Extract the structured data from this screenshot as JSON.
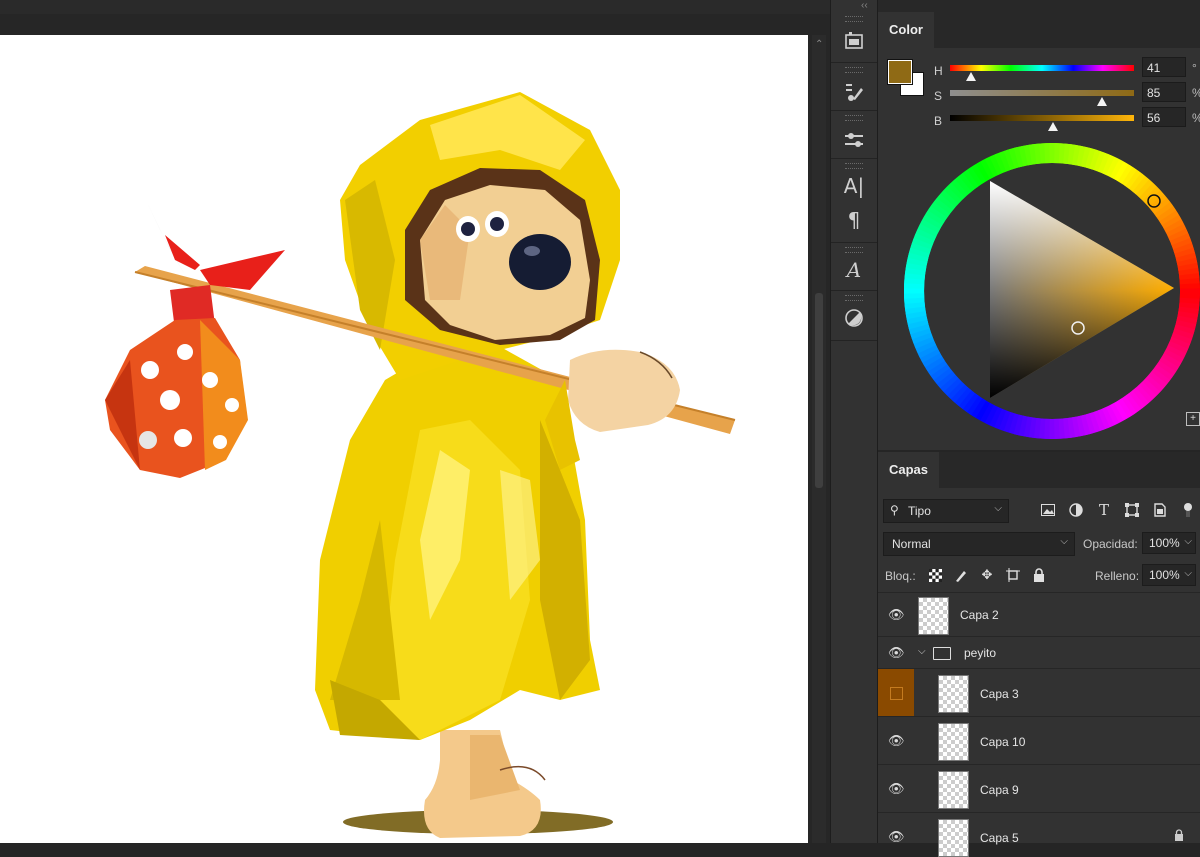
{
  "toolstrip": {
    "icons": [
      "layer-comps-icon",
      "brush-settings-icon",
      "adjustments-icon",
      "character-icon",
      "paragraph-icon",
      "glyphs-icon",
      "fill-opacity-icon"
    ]
  },
  "color_panel": {
    "tab": "Color",
    "foreground": "#8f6a15",
    "background": "#ffffff",
    "sliders": [
      {
        "label": "H",
        "value": "41",
        "unit": "°",
        "fraction": 0.11
      },
      {
        "label": "S",
        "value": "85",
        "unit": "%",
        "fraction": 0.85
      },
      {
        "label": "B",
        "value": "56",
        "unit": "%",
        "fraction": 0.56
      }
    ],
    "hue_color": "#ffad00"
  },
  "layers_panel": {
    "tab": "Capas",
    "filter": {
      "icon": "search-icon",
      "label": "Tipo"
    },
    "filter_icons": [
      "image-filter-icon",
      "adjustment-filter-icon",
      "type-filter-icon",
      "shape-filter-icon",
      "smart-object-filter-icon"
    ],
    "blend_mode": "Normal",
    "opacity_label": "Opacidad:",
    "opacity_value": "100%",
    "lock_label": "Bloq.:",
    "fill_label": "Relleno:",
    "fill_value": "100%",
    "layers": [
      {
        "name": "Capa 2",
        "visible": true,
        "type": "layer"
      },
      {
        "name": "peyito",
        "visible": true,
        "type": "group"
      },
      {
        "name": "Capa 3",
        "visible": false,
        "type": "layer"
      },
      {
        "name": "Capa 10",
        "visible": true,
        "type": "layer"
      },
      {
        "name": "Capa 9",
        "visible": true,
        "type": "layer"
      },
      {
        "name": "Capa 5",
        "visible": true,
        "type": "layer",
        "locked": true
      }
    ]
  },
  "colors": {
    "panel_bg": "#323232",
    "accent_layer": "#8a4a00",
    "raincoat": "#f2d000",
    "bundle": "#e0431a"
  }
}
